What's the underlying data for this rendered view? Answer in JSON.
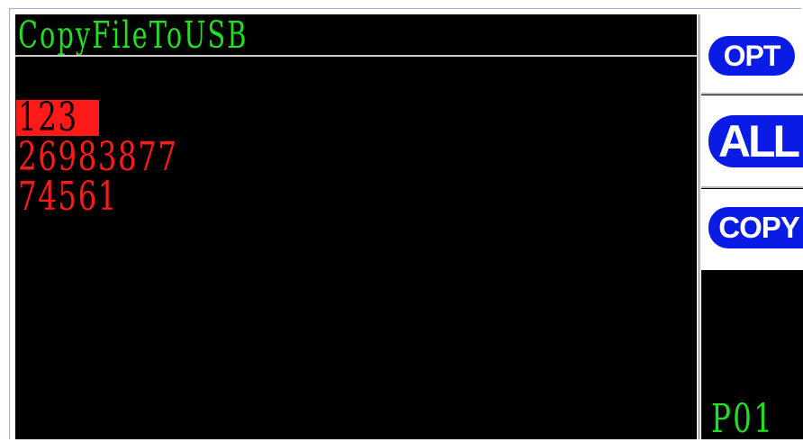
{
  "screen": {
    "title": "CopyFileToUSB",
    "title_color": "#1fe01f",
    "files": [
      {
        "name": "123",
        "selected": true
      },
      {
        "name": "26983877",
        "selected": false
      },
      {
        "name": "74561",
        "selected": false
      }
    ],
    "file_color": "#ff1a1a"
  },
  "side_panel": {
    "buttons": {
      "opt": "OPT",
      "all": "ALL",
      "copy": "COPY"
    },
    "button_color": "#0a1be6",
    "page_label": "P01"
  }
}
